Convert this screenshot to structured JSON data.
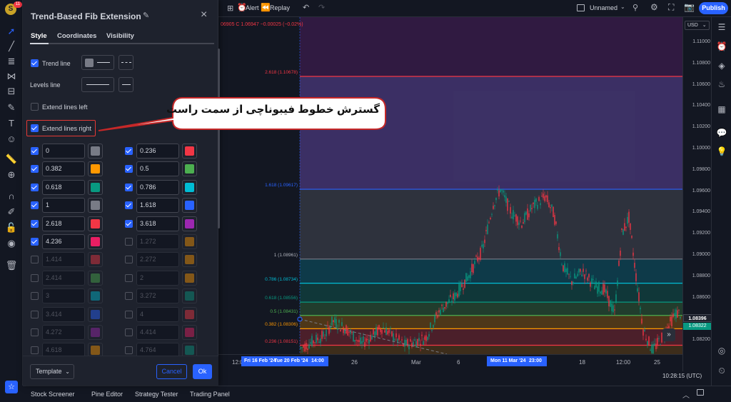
{
  "dialog": {
    "title": "Trend-Based Fib Extension",
    "tabs": [
      "Style",
      "Coordinates",
      "Visibility"
    ],
    "trend_line_label": "Trend line",
    "levels_line_label": "Levels line",
    "extend_left_label": "Extend lines left",
    "extend_right_label": "Extend lines right",
    "template_label": "Template",
    "cancel_label": "Cancel",
    "ok_label": "Ok",
    "levels_left": [
      {
        "value": "0",
        "checked": true,
        "color": "#787b86"
      },
      {
        "value": "0.382",
        "checked": true,
        "color": "#ff9800"
      },
      {
        "value": "0.618",
        "checked": true,
        "color": "#089981"
      },
      {
        "value": "1",
        "checked": true,
        "color": "#787b86"
      },
      {
        "value": "2.618",
        "checked": true,
        "color": "#f23645"
      },
      {
        "value": "4.236",
        "checked": true,
        "color": "#e91e63"
      },
      {
        "value": "1.414",
        "checked": false,
        "color": "#f23645"
      },
      {
        "value": "2.414",
        "checked": false,
        "color": "#4caf50"
      },
      {
        "value": "3",
        "checked": false,
        "color": "#00bcd4"
      },
      {
        "value": "3.414",
        "checked": false,
        "color": "#2962ff"
      },
      {
        "value": "4.272",
        "checked": false,
        "color": "#9c27b0"
      },
      {
        "value": "4.618",
        "checked": false,
        "color": "#ff9800"
      }
    ],
    "levels_right": [
      {
        "value": "0.236",
        "checked": true,
        "color": "#f23645"
      },
      {
        "value": "0.5",
        "checked": true,
        "color": "#4caf50"
      },
      {
        "value": "0.786",
        "checked": true,
        "color": "#00bcd4"
      },
      {
        "value": "1.618",
        "checked": true,
        "color": "#2962ff"
      },
      {
        "value": "3.618",
        "checked": true,
        "color": "#9c27b0"
      },
      {
        "value": "1.272",
        "checked": false,
        "color": "#ff9800"
      },
      {
        "value": "2.272",
        "checked": false,
        "color": "#ff9800"
      },
      {
        "value": "2",
        "checked": false,
        "color": "#ff9800"
      },
      {
        "value": "3.272",
        "checked": false,
        "color": "#089981"
      },
      {
        "value": "4",
        "checked": false,
        "color": "#f23645"
      },
      {
        "value": "4.414",
        "checked": false,
        "color": "#e91e63"
      },
      {
        "value": "4.764",
        "checked": false,
        "color": "#089981"
      }
    ]
  },
  "callout": {
    "text": "گسترش خطوط فیبوناچی از سمت راست"
  },
  "topbar": {
    "alert_label": "Alert",
    "replay_label": "Replay",
    "layout_name": "Unnamed",
    "publish_label": "Publish"
  },
  "header_badge": "11",
  "ohlc_text": "06905 C 1.06947 −0.00025 (−0.02%)",
  "currency": "USD",
  "price_ticks": [
    "1.11000",
    "1.10800",
    "1.10600",
    "1.10400",
    "1.10200",
    "1.10000",
    "1.09800",
    "1.09600",
    "1.09400",
    "1.09200",
    "1.09000",
    "1.08800",
    "1.08600",
    "1.08400",
    "1.08200"
  ],
  "current_price": "1.08396",
  "current_price2": "1.08322",
  "fib_labels": [
    {
      "text": "2.618 (1.10678)",
      "color": "#f23645"
    },
    {
      "text": "1.618 (1.09617)",
      "color": "#2962ff"
    },
    {
      "text": "1 (1.08961)",
      "color": "#b2b5be"
    },
    {
      "text": "0.786 (1.08734)",
      "color": "#00bcd4"
    },
    {
      "text": "0.618 (1.08556)",
      "color": "#089981"
    },
    {
      "text": "0.5 (1.08431)",
      "color": "#4caf50"
    },
    {
      "text": "0.382 (1.08306)",
      "color": "#ff9800"
    },
    {
      "text": "0.236 (1.08151)",
      "color": "#f23645"
    }
  ],
  "time_labels": [
    "12:0",
    "26",
    "Mar",
    "6",
    "18",
    "12:00",
    "25"
  ],
  "time_highlights": [
    "Fri 16 Feb '24",
    "Tue 20 Feb '24",
    "14:00",
    "Mon 11 Mar '24",
    "23:00"
  ],
  "clock": "10:28:15 (UTC)",
  "bottom_tabs": [
    "Stock Screener",
    "Pine Editor",
    "Strategy Tester",
    "Trading Panel"
  ]
}
